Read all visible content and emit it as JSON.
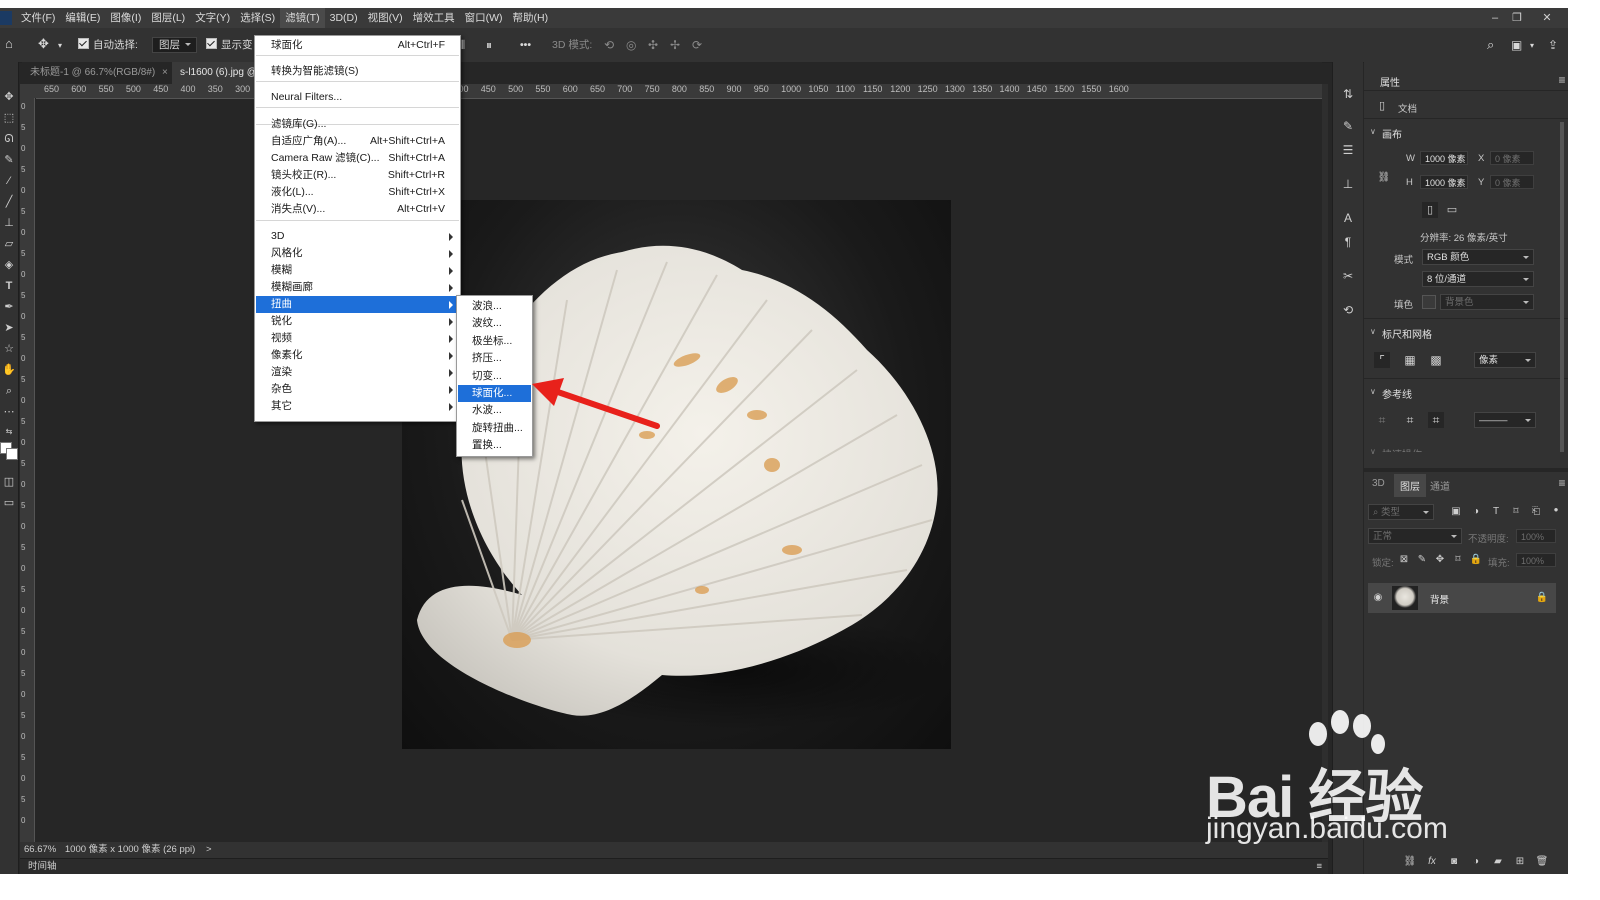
{
  "menubar": {
    "items": [
      "文件(F)",
      "编辑(E)",
      "图像(I)",
      "图层(L)",
      "文字(Y)",
      "选择(S)",
      "滤镜(T)",
      "3D(D)",
      "视图(V)",
      "增效工具",
      "窗口(W)",
      "帮助(H)"
    ],
    "active_index": 6
  },
  "options": {
    "auto_select_label": "自动选择:",
    "auto_select_value": "图层",
    "show_transform_label": "显示变",
    "mode_3d_label": "3D 模式:",
    "more_label": "•••"
  },
  "tabs": [
    {
      "label": "未标题-1 @ 66.7%(RGB/8#)",
      "close": "×",
      "active": false
    },
    {
      "label": "s-l1600 (6).jpg @",
      "active": true
    }
  ],
  "rulers": {
    "h": [
      "650",
      "600",
      "550",
      "500",
      "450",
      "400",
      "350",
      "300",
      "250",
      "100",
      "150",
      "200",
      "250",
      "300",
      "350",
      "400",
      "450",
      "500",
      "550",
      "600",
      "650",
      "700",
      "750",
      "800",
      "850",
      "900",
      "950",
      "1000",
      "1050",
      "1100",
      "1150",
      "1200",
      "1250",
      "1300",
      "1350",
      "1400",
      "1450",
      "1500",
      "1550",
      "1600"
    ],
    "v": [
      "0",
      "5",
      "0",
      "5",
      "0",
      "5",
      "0",
      "5",
      "0",
      "5",
      "0",
      "5",
      "0",
      "5",
      "0",
      "5",
      "0",
      "5",
      "0",
      "5",
      "0",
      "5",
      "0",
      "5",
      "0",
      "5",
      "0",
      "5",
      "0",
      "5",
      "0",
      "5",
      "0",
      "5",
      "0"
    ]
  },
  "status": {
    "zoom": "66.67%",
    "doc_info": "1000 像素 x 1000 像素 (26 ppi)",
    "more": ">"
  },
  "timeline": {
    "label": "时间轴"
  },
  "filter_menu": {
    "items": [
      {
        "label": "球面化",
        "shortcut": "Alt+Ctrl+F"
      },
      {
        "label": "转换为智能滤镜(S)",
        "shortcut": ""
      },
      {
        "label": "Neural Filters...",
        "shortcut": ""
      },
      {
        "label": "滤镜库(G)...",
        "shortcut": ""
      },
      {
        "label": "自适应广角(A)...",
        "shortcut": "Alt+Shift+Ctrl+A"
      },
      {
        "label": "Camera Raw 滤镜(C)...",
        "shortcut": "Shift+Ctrl+A"
      },
      {
        "label": "镜头校正(R)...",
        "shortcut": "Shift+Ctrl+R"
      },
      {
        "label": "液化(L)...",
        "shortcut": "Shift+Ctrl+X"
      },
      {
        "label": "消失点(V)...",
        "shortcut": "Alt+Ctrl+V"
      },
      {
        "label": "3D"
      },
      {
        "label": "风格化"
      },
      {
        "label": "模糊"
      },
      {
        "label": "模糊画廊"
      },
      {
        "label": "扭曲"
      },
      {
        "label": "锐化"
      },
      {
        "label": "视频"
      },
      {
        "label": "像素化"
      },
      {
        "label": "渲染"
      },
      {
        "label": "杂色"
      },
      {
        "label": "其它"
      }
    ],
    "highlighted_index": 13
  },
  "distort_submenu": {
    "items": [
      "波浪...",
      "波纹...",
      "极坐标...",
      "挤压...",
      "切变...",
      "球面化...",
      "水波...",
      "旋转扭曲...",
      "置换..."
    ],
    "highlighted_index": 5
  },
  "properties": {
    "tab": "属性",
    "doc_label": "文档",
    "canvas_section": "画布",
    "w_label": "W",
    "w_value": "1000 像素",
    "x_label": "X",
    "x_value": "0 像素",
    "h_label": "H",
    "h_value": "1000 像素",
    "y_label": "Y",
    "y_value": "0 像素",
    "resolution": "分辨率: 26 像素/英寸",
    "mode_label": "模式",
    "mode_value": "RGB 颜色",
    "depth_value": "8 位/通道",
    "fill_label": "填色",
    "fill_value": "背景色",
    "rulers_section": "标尺和网格",
    "units_value": "像素",
    "guides_section": "参考线",
    "cut_section": "快速操作"
  },
  "layers": {
    "tabs": [
      "3D",
      "图层",
      "通道"
    ],
    "active_tab": 1,
    "filter_placeholder": "类型",
    "blend_mode": "正常",
    "opacity_label": "不透明度:",
    "opacity_value": "100%",
    "lock_label": "锁定:",
    "fill_label": "填充:",
    "fill_value": "100%",
    "layer_name": "背景"
  },
  "watermark": {
    "brand": "Bai  经验",
    "url": "jingyan.baidu.com"
  },
  "colors": {
    "highlight": "#1e6fd9",
    "arrow": "#e8211b",
    "panel_bg": "#323232",
    "workspace_bg": "#262626"
  }
}
